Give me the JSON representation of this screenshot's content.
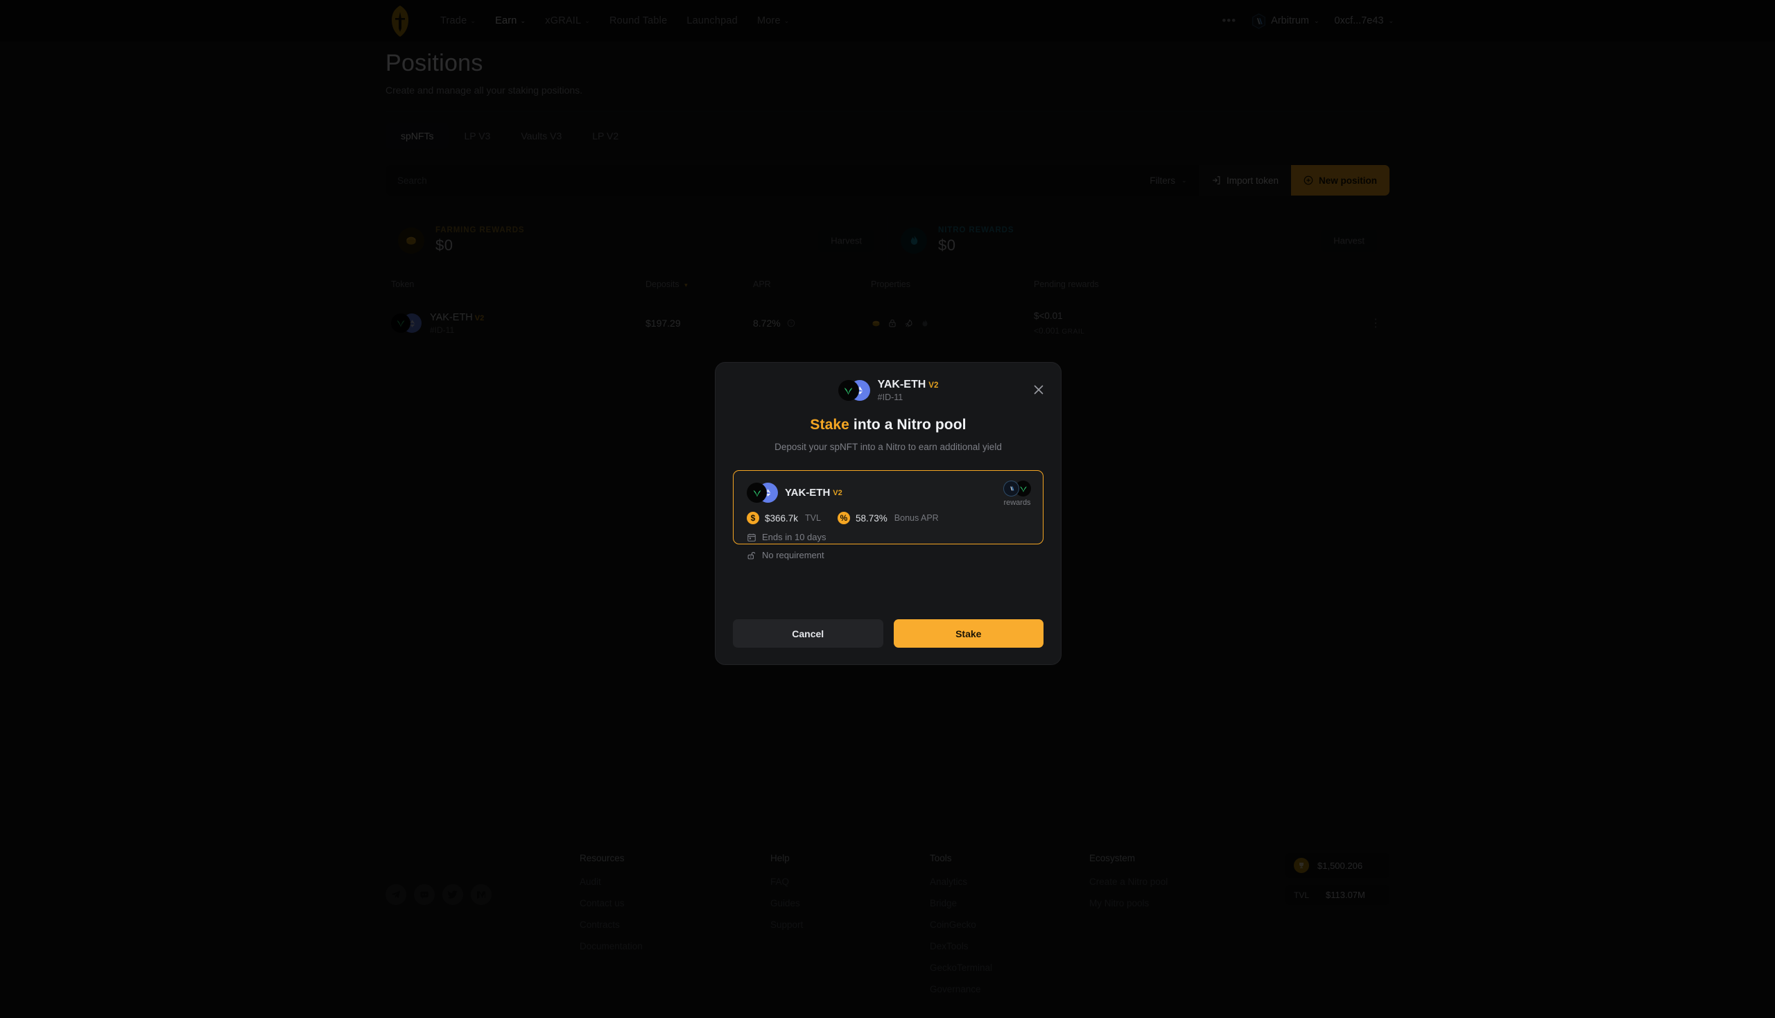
{
  "nav": {
    "logo_icon": "paladin-shield-logo",
    "links": [
      {
        "label": "Trade",
        "has_caret": true,
        "active": false
      },
      {
        "label": "Earn",
        "has_caret": true,
        "active": true
      },
      {
        "label": "xGRAIL",
        "has_caret": true,
        "active": false
      },
      {
        "label": "Round Table",
        "has_caret": false,
        "active": false
      },
      {
        "label": "Launchpad",
        "has_caret": false,
        "active": false
      },
      {
        "label": "More",
        "has_caret": true,
        "active": false
      }
    ],
    "more_dots": "•••",
    "chain": "Arbitrum",
    "wallet": "0xcf...7e43",
    "caret": "⌄"
  },
  "page": {
    "title": "Positions",
    "subtitle": "Create and manage all your staking positions."
  },
  "tabs": [
    {
      "label": "spNFTs",
      "active": true
    },
    {
      "label": "LP V3",
      "active": false
    },
    {
      "label": "Vaults V3",
      "active": false
    },
    {
      "label": "LP V2",
      "active": false
    }
  ],
  "toolbar": {
    "search_placeholder": "Search",
    "search_value": "",
    "filters_label": "Filters",
    "import_label": "Import token",
    "new_position_label": "New position"
  },
  "reward_cards": [
    {
      "label": "FARMING REWARDS",
      "value": "$0",
      "action": "Harvest",
      "icon": "coin-icon",
      "accent": "#8a6a22"
    },
    {
      "label": "NITRO REWARDS",
      "value": "$0",
      "action": "Harvest",
      "icon": "flame-icon",
      "accent": "#1f6f86"
    }
  ],
  "table": {
    "headers": {
      "token": "Token",
      "deposits": "Deposits",
      "deposits_sort": "▾",
      "apr": "APR",
      "properties": "Properties",
      "pending": "Pending rewards"
    },
    "rows": [
      {
        "token_name": "YAK-ETH",
        "token_version": "V2",
        "token_id": "#ID-11",
        "deposits": "$197.29",
        "apr": "8.72%",
        "apr_info_icon": "info-icon",
        "property_icons": [
          "coin-icon",
          "lock-icon",
          "rocket-icon",
          "flame-icon"
        ],
        "pending_usd": "$<0.01",
        "pending_token": "<0.001",
        "pending_symbol": "GRAIL",
        "menu_icon": "kebab-menu-icon"
      }
    ]
  },
  "modal": {
    "token_name": "YAK-ETH",
    "token_version": "V2",
    "token_id": "#ID-11",
    "close_icon": "close-icon",
    "title_highlight": "Stake",
    "title_rest": " into a Nitro pool",
    "description": "Deposit your spNFT into a Nitro to earn additional yield",
    "pool": {
      "name": "YAK-ETH",
      "version": "V2",
      "rewards_label": "rewards",
      "reward_icons": [
        "arbitrum-icon",
        "yak-icon"
      ],
      "tvl_value": "$366.7k",
      "tvl_label": "TVL",
      "tvl_badge": "$",
      "apr_value": "58.73%",
      "apr_label": "Bonus APR",
      "apr_badge": "%",
      "ends_text": "Ends in 10 days",
      "ends_icon": "calendar-icon",
      "requirement_text": "No requirement",
      "requirement_icon": "unlock-icon"
    },
    "cancel_label": "Cancel",
    "stake_label": "Stake",
    "accent_color": "#f5a623"
  },
  "footer": {
    "socials": [
      "telegram-icon",
      "discord-icon",
      "twitter-icon",
      "medium-icon"
    ],
    "columns": [
      {
        "title": "Resources",
        "links": [
          "Audit",
          "Contact us",
          "Contracts",
          "Documentation"
        ]
      },
      {
        "title": "Help",
        "links": [
          "FAQ",
          "Guides",
          "Support"
        ]
      },
      {
        "title": "Tools",
        "links": [
          "Analytics",
          "Bridge",
          "CoinGecko",
          "DexTools",
          "GeckoTerminal",
          "Governance"
        ]
      },
      {
        "title": "Ecosystem",
        "links": [
          "Create a Nitro pool",
          "My Nitro pools"
        ]
      }
    ],
    "stats": [
      {
        "icon": "grail-coin-icon",
        "key": "",
        "value": "$1,500.206"
      },
      {
        "icon": "",
        "key": "TVL",
        "value": "$113.07M"
      }
    ]
  }
}
